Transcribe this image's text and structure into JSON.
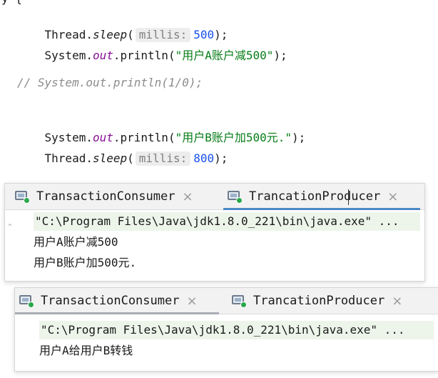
{
  "code": {
    "brace": "y {",
    "line1": {
      "cls": "Thread.",
      "method": "sleep",
      "open": "(",
      "hint": "millis:",
      "value": "500",
      "close": ");"
    },
    "line2": {
      "cls": "System.",
      "field": "out",
      "call": ".println(",
      "str": "\"用户A账户减500\"",
      "close": ");"
    },
    "line3": {
      "comment": "// System.out.println(1/0);"
    },
    "line4": {
      "cls": "System.",
      "field": "out",
      "call": ".println(",
      "str": "\"用户B账户加500元.\"",
      "close": ");"
    },
    "line5": {
      "cls": "Thread.",
      "method": "sleep",
      "open": "(",
      "hint": "millis:",
      "value": "800",
      "close": ");"
    }
  },
  "panel1": {
    "tabs": [
      {
        "label": "TransactionConsumer",
        "close": "×"
      },
      {
        "label": "TrancationProducer",
        "close": "×"
      }
    ],
    "lines": [
      "\"C:\\Program Files\\Java\\jdk1.8.0_221\\bin\\java.exe\" ...",
      "用户A账户减500",
      "用户B账户加500元."
    ]
  },
  "panel2": {
    "tabs": [
      {
        "label": "TransactionConsumer",
        "close": "×"
      },
      {
        "label": "TrancationProducer",
        "close": "×"
      }
    ],
    "lines": [
      "\"C:\\Program Files\\Java\\jdk1.8.0_221\\bin\\java.exe\" ...",
      "用户A给用户B转钱"
    ]
  },
  "colors": {
    "active_tab_underline": "#4a88c7",
    "inactive_tab_underline": "#a8adb4",
    "command_line_bg": "#edf5ea"
  }
}
